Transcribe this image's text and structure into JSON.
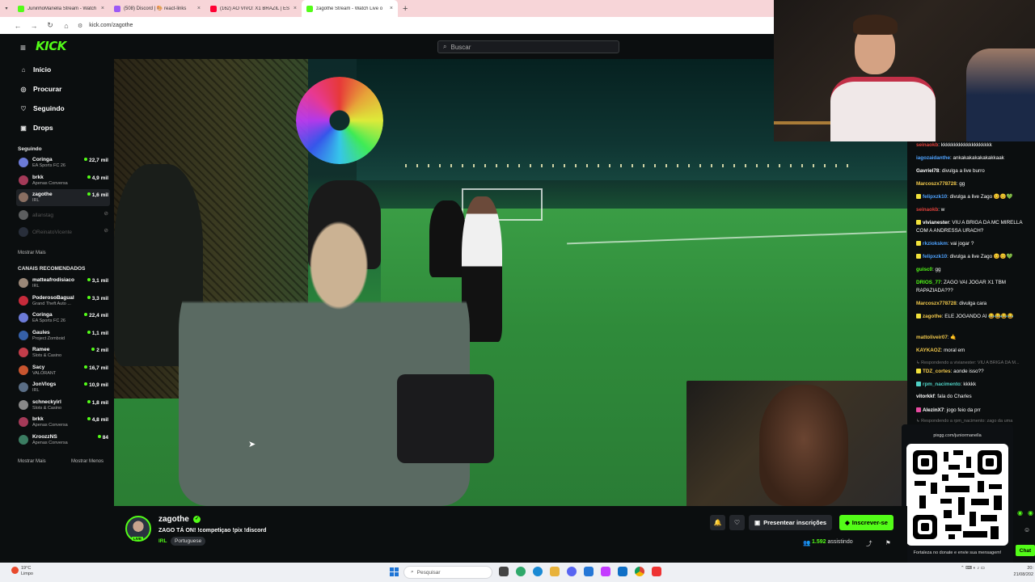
{
  "browser": {
    "tabs": [
      {
        "label": "JuninhoManella Stream - Watch",
        "color": "#53fc18"
      },
      {
        "label": "(508) Discord | 🎨 react-links",
        "color": "#9b59f5"
      },
      {
        "label": "(162) AO VIVO: X1 BRAZIL | ES",
        "color": "#ff0033"
      },
      {
        "label": "zagothe Stream - Watch Live o",
        "color": "#53fc18"
      }
    ],
    "tab_close": "×",
    "new_tab": "+",
    "url": "kick.com/zagothe"
  },
  "header": {
    "logo": "KICK",
    "search_placeholder": "Buscar"
  },
  "sidebar": {
    "nav": [
      {
        "label": "Início",
        "icon": "home-icon",
        "glyph": "⌂"
      },
      {
        "label": "Procurar",
        "icon": "compass-icon",
        "glyph": "◎"
      },
      {
        "label": "Seguindo",
        "icon": "heart-icon",
        "glyph": "♡"
      },
      {
        "label": "Drops",
        "icon": "gift-icon",
        "glyph": "▣"
      }
    ],
    "following_title": "Seguindo",
    "following": [
      {
        "name": "Coringa",
        "category": "EA Sports FC 26",
        "viewers": "22,7 mil",
        "color": "#6c7bd8"
      },
      {
        "name": "brkk",
        "category": "Apenas Conversa",
        "viewers": "4,9 mil",
        "color": "#a43a58"
      },
      {
        "name": "zagothe",
        "category": "IRL",
        "viewers": "1,6 mil",
        "color": "#8a6f62"
      },
      {
        "name": "allanstag",
        "category": "",
        "viewers": "",
        "color": "#d8d8d8"
      },
      {
        "name": "OReinatoVicente",
        "category": "",
        "viewers": "",
        "color": "#55607a"
      }
    ],
    "show_more": "Mostrar Mais",
    "recommended_title": "CANAIS RECOMENDADOS",
    "recommended": [
      {
        "name": "matteafrodisiaco",
        "category": "IRL",
        "viewers": "3,1 mil",
        "color": "#9a8777"
      },
      {
        "name": "PoderosoBagual",
        "category": "Grand Theft Auto ...",
        "viewers": "3,3 mil",
        "color": "#c62b3b"
      },
      {
        "name": "Coringa",
        "category": "EA Sports FC 26",
        "viewers": "22,4 mil",
        "color": "#6c7bd8"
      },
      {
        "name": "Gaules",
        "category": "Project Zomboid",
        "viewers": "1,1 mil",
        "color": "#3560a8"
      },
      {
        "name": "Ramee",
        "category": "Slots & Casino",
        "viewers": "2 mil",
        "color": "#c23d4a"
      },
      {
        "name": "Sacy",
        "category": "VALORANT",
        "viewers": "16,7 mil",
        "color": "#c8552f"
      },
      {
        "name": "JonVlogs",
        "category": "IRL",
        "viewers": "10,9 mil",
        "color": "#5a6e86"
      },
      {
        "name": "schneckyirl",
        "category": "Slots & Casino",
        "viewers": "1,8 mil",
        "color": "#888888"
      },
      {
        "name": "brkk",
        "category": "Apenas Conversa",
        "viewers": "4,8 mil",
        "color": "#a43a58"
      },
      {
        "name": "KroozzNS",
        "category": "Apenas Conversa",
        "viewers": "84",
        "color": "#3b7d62"
      }
    ],
    "show_more2": "Mostrar Mais",
    "show_less": "Mostrar Menos"
  },
  "channel": {
    "name": "zagothe",
    "live_badge": "LIVE",
    "verified_glyph": "✓",
    "title": "ZAGO TÁ ON! !competiçao !pix !discord",
    "category": "IRL",
    "tag": "Portuguese",
    "subscriptions_label": "Presentear inscrições",
    "follow_label": "Inscrever-se",
    "viewers_count": "1.592",
    "viewers_label": "assistindo"
  },
  "chat": {
    "messages": [
      {
        "user": "seinaokb",
        "color": "#e0413b",
        "text": "kkkkkkkkkkkkkkkkkkkk"
      },
      {
        "user": "iagozaidanthe",
        "color": "#4fa3ff",
        "text": "ankakakakakakakkaak"
      },
      {
        "user": "Gavriel78",
        "color": "#ffffff",
        "text": "divulga a live burro"
      },
      {
        "user": "Marcoszx778728",
        "color": "#f2c94c",
        "text": "gg"
      },
      {
        "user": "felipxzk10",
        "color": "#4fa3ff",
        "text": "divulga a live Zago 😊😊💚",
        "badge": "#f2e23b"
      },
      {
        "user": "seinaokb",
        "color": "#e0413b",
        "text": "w"
      },
      {
        "user": "vivianester",
        "color": "#ffffff",
        "text": "VIU A BRIGA DA MC MIRELLA COM A ANDRESSA URACH?",
        "badge": "#f2e23b"
      },
      {
        "user": "rkziokskm",
        "color": "#4fa3ff",
        "text": "vai jogar ?",
        "badge": "#f2e23b"
      },
      {
        "user": "felipxzk10",
        "color": "#4fa3ff",
        "text": "divulga a live Zago 😊😊💚",
        "badge": "#f2e23b"
      },
      {
        "user": "guisc0",
        "color": "#53fc18",
        "text": "gg"
      },
      {
        "user": "DRIOS_77",
        "color": "#53fc18",
        "text": "ZAGO VAI JOGAR X1 TBM RAPAZIADA???"
      },
      {
        "user": "Marcoszx778728",
        "color": "#f2c94c",
        "text": "divulga cara"
      },
      {
        "user": "zagothe",
        "color": "#f2c94c",
        "text": "ELE JOGANDO AI 😂😂😂😂",
        "badge": "#f2e23b"
      },
      {
        "user": "mattoliveir07",
        "color": "#f2c94c",
        "text": "🤙"
      },
      {
        "user": "KAYKAOZ",
        "color": "#f2c94c",
        "text": "moral em"
      },
      {
        "reply": "↳ Respondendo a vivianester: VIU A BRIGA DA M..."
      },
      {
        "user": "TDZ_cortes",
        "color": "#f2c94c",
        "text": "aonde isso??",
        "badge": "#f2e23b"
      },
      {
        "user": "rpm_nacimento",
        "color": "#4fd1c5",
        "text": "kkkkk",
        "badge": "#4fd1c5"
      },
      {
        "user": "vitorkkf",
        "color": "#ffffff",
        "text": "fala do Charles"
      },
      {
        "user": "AlezinX7",
        "color": "#ffffff",
        "text": "jogo feio da prr",
        "badge": "#e84aa0"
      },
      {
        "reply": "↳ Respondendo a rpm_nacimento: zago da uma"
      }
    ]
  },
  "qr_widget": {
    "url": "pixgg.com/juniormanella",
    "footer": "Fortaleza no donate e envie sua mensagem!"
  },
  "chat_button": "Chat",
  "taskbar": {
    "weather_temp": "19°C",
    "weather_desc": "Limpo",
    "search_placeholder": "Pesquisar",
    "time": "20:",
    "date": "21/08/202"
  }
}
